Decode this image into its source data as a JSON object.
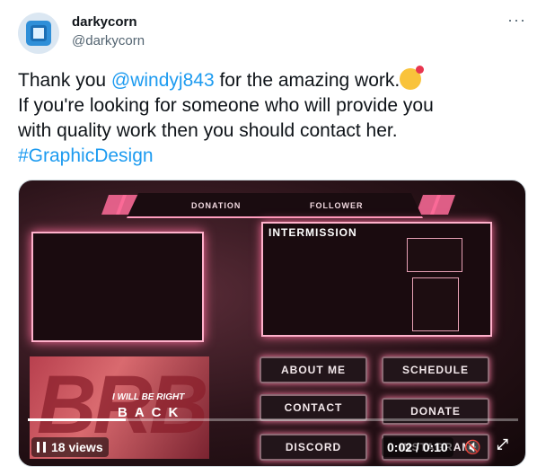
{
  "author": {
    "name": "darkycorn",
    "handle": "@darkycorn"
  },
  "more_label": "···",
  "tweet": {
    "prefix": "Thank you ",
    "mention": "@windyj843",
    "suffix": " for the amazing work.",
    "line2": "If you're looking for someone who will provide you",
    "line3": "with quality work then you should contact her.",
    "hashtag": "#GraphicDesign"
  },
  "media": {
    "top_bar": {
      "left_label": "DONATION",
      "right_label": "FOLLOWER"
    },
    "intermission_title": "INTERMISSION",
    "brb": {
      "big_text": "BRB",
      "line1": "I WILL BE RIGHT",
      "line2": "BACK"
    },
    "buttons": [
      "ABOUT ME",
      "SCHEDULE",
      "CONTACT",
      "DONATE",
      "DISCORD",
      "INSTAGRAM"
    ],
    "player": {
      "views": "18 views",
      "time": "0:02 / 0:10",
      "progress": 0.2,
      "mute_icon": "speaker-muted-icon",
      "fullscreen_icon": "fullscreen-icon"
    }
  },
  "colors": {
    "link": "#1d9bf0",
    "accent_pink": "#ff6f9c"
  }
}
